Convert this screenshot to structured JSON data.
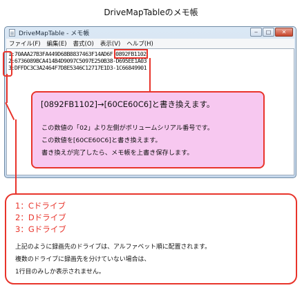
{
  "page": {
    "title": "DriveMapTableのメモ帳"
  },
  "window": {
    "title": "DriveMapTable - メモ帳",
    "controls": {
      "minimize": "‒",
      "maximize": "□",
      "close": "✕"
    },
    "menu": [
      "ファイル(F)",
      "編集(E)",
      "書式(O)",
      "表示(V)",
      "ヘルプ(H)"
    ]
  },
  "editor": {
    "lines": [
      {
        "number": "1:",
        "text": "70AAA27B3FA449D68B8837463F14AD6F",
        "highlight": "0892FB1102"
      },
      {
        "number": "2:",
        "text": "6736089BCA414B4D9097C5097E250B38-D695EE1A03",
        "highlight": ""
      },
      {
        "number": "3:",
        "text": "DFFDC3C3A2464F7D8E5346C12717E1D3-1C66849901",
        "highlight": ""
      }
    ]
  },
  "callout_top": {
    "heading": "[0892FB1102]→[60CE60C6]と書き換えます。",
    "lines": [
      "この数値の「02」より左側がボリュームシリアル番号です。",
      "この数値を[60CE60C6]と書き換えます。",
      "書き換えが完了したら、メモ帳を上書き保存します。"
    ]
  },
  "callout_bottom": {
    "drives": [
      "1：Cドライブ",
      "2：Dドライブ",
      "3：Gドライブ"
    ],
    "lines": [
      "上記のように録画先のドライブは、アルファベット順に配置されます。",
      "複数のドライブに録画先を分けていない場合は、",
      "1行目のみしか表示されません。"
    ]
  },
  "colors": {
    "accent": "#e8332a",
    "callout_fill": "#f7c8f0"
  }
}
